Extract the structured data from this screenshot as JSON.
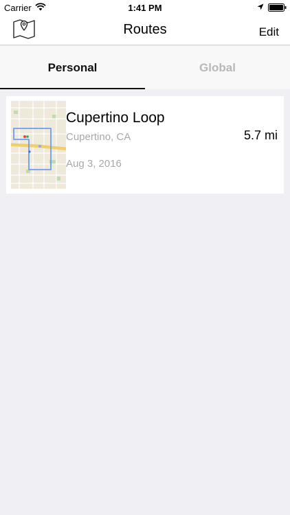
{
  "status_bar": {
    "carrier": "Carrier",
    "time": "1:41 PM"
  },
  "nav": {
    "title": "Routes",
    "edit_label": "Edit",
    "left_icon": "map-pin-icon"
  },
  "tabs": [
    {
      "label": "Personal",
      "selected": true
    },
    {
      "label": "Global",
      "selected": false
    }
  ],
  "routes": [
    {
      "name": "Cupertino Loop",
      "location": "Cupertino, CA",
      "date": "Aug 3, 2016",
      "distance": "5.7 mi"
    }
  ],
  "colors": {
    "background": "#efeff4",
    "inactive_tab": "#b8b8b8",
    "secondary_text": "#a8a8a8",
    "route_line": "#6b9cf0"
  }
}
